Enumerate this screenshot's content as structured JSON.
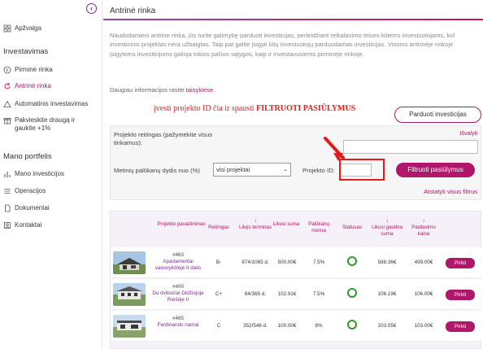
{
  "sidebar": {
    "top_item": "Apžvalga",
    "section_invest": "Investavimas",
    "invest_items": [
      "Pirminė rinka",
      "Antrinė rinka",
      "Automatinis investavimas",
      "Pakvieskite draugą ir gaukite +1%"
    ],
    "section_portfolio": "Mano portfelis",
    "portfolio_items": [
      "Mano investicijos",
      "Operacijos",
      "Dokumentai",
      "Kontaktai"
    ],
    "accent": "#b0166a"
  },
  "main": {
    "title": "Antrinė rinka",
    "intro": "Naudodamiesi antrine rinka, jūs turite galimybę parduoti investicijas, perleidžiant reikalavimo teises kitiems investuotojams, kol investicinis projektas nėra užbaigtas. Taip pat galite įsigyti kitų investuotojų parduodamas investicijas. Visoms antrinėje rinkoje įsigytoms investicijoms galioja tokios pačios sąlygos, kaip ir investavusiems pirminėje rinkoje.",
    "more_info_prefix": "Daugiau informacijos rasite",
    "more_info_link": "taisyklėse.",
    "annotation_text": "įvesti projekto ID čia ir spausti",
    "annotation_bold": "FILTRUOTI PASIŪLYMUS",
    "sell_button": "Parduoti investicijas"
  },
  "filters": {
    "rating_label": "Projekto reitingas (pažymėkite visus tinkamus):",
    "clear": "Išvalyti",
    "rate_label": "Metinių palūkanų dydis nuo (%)",
    "rate_value": "visi projektai",
    "id_label": "Projekto ID:",
    "id_value": "",
    "filter_button": "Filtruoti pasiūlymus",
    "reset": "Atstatyti visus filtrus"
  },
  "table": {
    "headers": [
      "Projekto pavadinimas",
      "Reitingas",
      "Likęs terminas",
      "Likusi suma",
      "Palūkanų norma",
      "Statusas",
      "Likusi gautina suma",
      "Pardavimo kaina"
    ],
    "buy_label": "Pirkti",
    "rows": [
      {
        "id": "#463",
        "name": "Apartamentai vaivorykštėje II dalis",
        "rating": "B-",
        "term": "874/1065 d.",
        "remaining": "500.00€",
        "rate": "7.5%",
        "receivable": "588.36€",
        "price": "499.00€"
      },
      {
        "id": "#400",
        "name": "Du dvibučiai Didžiojoje Riešėje II",
        "rating": "C+",
        "term": "84/365 d.",
        "remaining": "102.91€",
        "rate": "7.5%",
        "receivable": "106.19€",
        "price": "106.00€"
      },
      {
        "id": "#465",
        "name": "Ferdinando namai",
        "rating": "C",
        "term": "352/546 d.",
        "remaining": "100.00€",
        "rate": "8%",
        "receivable": "103.05€",
        "price": "103.00€"
      }
    ]
  }
}
